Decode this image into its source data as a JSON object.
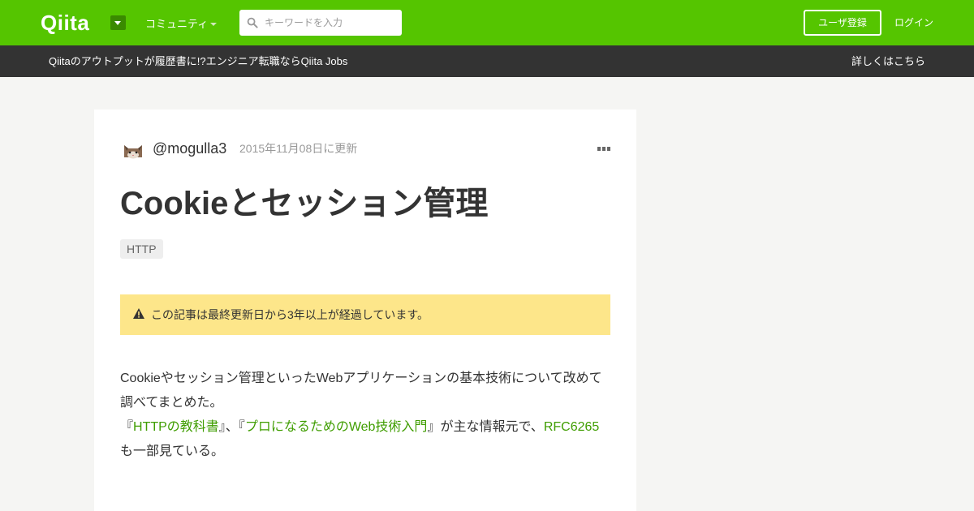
{
  "nav": {
    "logo": "Qiita",
    "community": "コミュニティ",
    "search_placeholder": "キーワードを入力",
    "signup": "ユーザ登録",
    "login": "ログイン"
  },
  "banner": {
    "text": "Qiitaのアウトプットが履歴書に!?エンジニア転職ならQiita Jobs",
    "link": "詳しくはこちら"
  },
  "article": {
    "username": "@mogulla3",
    "updated": "2015年11月08日に更新",
    "title": "Cookieとセッション管理",
    "tags": [
      "HTTP"
    ],
    "alert": "この記事は最終更新日から3年以上が経過しています。",
    "body": {
      "p1": "Cookieやセッション管理といったWebアプリケーションの基本技術について改めて調べてまとめた。",
      "q1_open": "『",
      "link1": "HTTPの教科書",
      "q1_close": "』、『",
      "link2": "プロになるためのWeb技術入門",
      "q2_close": "』が主な情報元で、",
      "link3": "RFC6265",
      "tail": "も一部見ている。"
    }
  },
  "colors": {
    "brand": "#55c500",
    "banner": "#333333",
    "alert": "#fde68a",
    "link": "#3f9d00"
  },
  "icons": [
    "dropdown-icon",
    "caret-down-icon",
    "search-icon",
    "cat-avatar",
    "more-icon",
    "warning-icon"
  ]
}
